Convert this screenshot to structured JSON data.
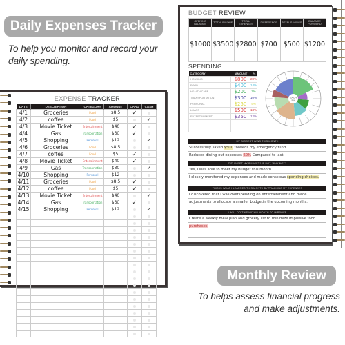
{
  "left_banner": {
    "title": "Daily Expenses Tracker",
    "subtitle": "To help you monitor and record your daily spending."
  },
  "right_banner": {
    "title": "Monthly Review",
    "subtitle_line1": "To helps assess financial progress",
    "subtitle_line2": "and make adjustments."
  },
  "expense_tracker": {
    "title_light": "EXPENSE",
    "title_bold": "TRACKER",
    "columns": [
      "DATE",
      "DESCRIPTION",
      "CATEGORY",
      "AMOUNT",
      "CARD",
      "CASH"
    ],
    "check_glyph": "✓",
    "category_colors": {
      "Food": "#f0a040",
      "Entertainment": "#e04848",
      "Transportation": "#3aaa55",
      "Personal": "#4a90d8"
    },
    "rows": [
      {
        "date": "4/1",
        "description": "Groceries",
        "category": "Food",
        "amount": "$8.5",
        "card": true,
        "cash": false
      },
      {
        "date": "4/2",
        "description": "coffee",
        "category": "Food",
        "amount": "$5",
        "card": false,
        "cash": true
      },
      {
        "date": "4/3",
        "description": "Movie Ticket",
        "category": "Entertainment",
        "amount": "$40",
        "card": true,
        "cash": false
      },
      {
        "date": "4/4",
        "description": "Gas",
        "category": "Transportation",
        "amount": "$30",
        "card": true,
        "cash": false
      },
      {
        "date": "4/5",
        "description": "Shopping",
        "category": "Personal",
        "amount": "$12",
        "card": false,
        "cash": true
      },
      {
        "date": "4/6",
        "description": "Groceries",
        "category": "Food",
        "amount": "$8.5",
        "card": false,
        "cash": false
      },
      {
        "date": "4/7",
        "description": "coffee",
        "category": "Food",
        "amount": "$5",
        "card": true,
        "cash": false
      },
      {
        "date": "4/8",
        "description": "Movie Ticket",
        "category": "Entertainment",
        "amount": "$40",
        "card": true,
        "cash": false
      },
      {
        "date": "4/9",
        "description": "Gas",
        "category": "Transportation",
        "amount": "$30",
        "card": false,
        "cash": true
      },
      {
        "date": "4/10",
        "description": "Shopping",
        "category": "Personal",
        "amount": "$12",
        "card": false,
        "cash": false
      },
      {
        "date": "4/11",
        "description": "Groceries",
        "category": "Food",
        "amount": "$8.5",
        "card": true,
        "cash": false
      },
      {
        "date": "4/12",
        "description": "coffee",
        "category": "Food",
        "amount": "$5",
        "card": true,
        "cash": false
      },
      {
        "date": "4/13",
        "description": "Movie Ticket",
        "category": "Entertainment",
        "amount": "$40",
        "card": false,
        "cash": true
      },
      {
        "date": "4/14",
        "description": "Gas",
        "category": "Transportation",
        "amount": "$30",
        "card": true,
        "cash": false
      },
      {
        "date": "4/15",
        "description": "Shopping",
        "category": "Personal",
        "amount": "$12",
        "card": false,
        "cash": true
      }
    ],
    "empty_rows": 18
  },
  "budget_review": {
    "title_light": "BUDGET",
    "title_bold": "REVIEW",
    "columns": [
      {
        "label": "OPENING BALANCE",
        "value": "$1000"
      },
      {
        "label": "TOTAL INCOME",
        "value": "$3500"
      },
      {
        "label": "TOTAL EXPENSES",
        "value": "$2800"
      },
      {
        "label": "DIFFERENCE",
        "value": "$700"
      },
      {
        "label": "TOTAL SAVINGS",
        "value": "$500"
      },
      {
        "label": "BALANCE FORWARD",
        "value": "$1200"
      }
    ]
  },
  "spending": {
    "title": "SPENDING",
    "columns": [
      "CATEGORY",
      "AMOUNT",
      "%"
    ],
    "rows": [
      {
        "category": "HOUSING",
        "amount": "$800",
        "pct": "28%",
        "color": "#e04848"
      },
      {
        "category": "FOOD",
        "amount": "$400",
        "pct": "14%",
        "color": "#40b8d8"
      },
      {
        "category": "HEALTH CARE",
        "amount": "$200",
        "pct": "7%",
        "color": "#3aaa55"
      },
      {
        "category": "TRANSPORTATION",
        "amount": "$300",
        "pct": "10%",
        "color": "#3a3a9a"
      },
      {
        "category": "PERSONAL",
        "amount": "$250",
        "pct": "9%",
        "color": "#d8d840"
      },
      {
        "category": "LOANS",
        "amount": "$500",
        "pct": "18%",
        "color": "#d83030"
      },
      {
        "category": "ENTERTAINMENT",
        "amount": "$350",
        "pct": "12%",
        "color": "#6a3a9a"
      }
    ],
    "empty_rows": 2
  },
  "chart_data": {
    "type": "polar-area",
    "center_label_line1": "EACH",
    "center_label_line2": "5%",
    "ring_step_pct": 5,
    "spokes": 20,
    "segments": [
      {
        "name": "segment-green",
        "color": "#6cc47a",
        "value": 28,
        "span_deg": 65
      },
      {
        "name": "segment-purple",
        "color": "#a46cc8",
        "value": 18,
        "span_deg": 30
      },
      {
        "name": "segment-dark-green",
        "color": "#3ea040",
        "value": 20,
        "span_deg": 35
      },
      {
        "name": "segment-teal",
        "color": "#70c8c8",
        "value": 22,
        "span_deg": 45
      },
      {
        "name": "segment-tan",
        "color": "#deb48c",
        "value": 26,
        "span_deg": 60
      },
      {
        "name": "segment-light-green",
        "color": "#b8dcb0",
        "value": 24,
        "span_deg": 40
      },
      {
        "name": "segment-brown",
        "color": "#a86060",
        "value": 27,
        "span_deg": 20
      },
      {
        "name": "segment-blue",
        "color": "#6c80cc",
        "value": 25,
        "span_deg": 65
      }
    ]
  },
  "reflections": [
    {
      "heading": "MY BIGGEST WINS THIS MONTH",
      "lines": [
        [
          {
            "t": "Successfully saved "
          },
          {
            "t": "$500",
            "hl": "y"
          },
          {
            "t": " towards my emergency fund."
          }
        ],
        [
          {
            "t": "Reduced dining-out expenses "
          },
          {
            "t": "60%",
            "hl": "r"
          },
          {
            "t": " Compared to last."
          }
        ]
      ]
    },
    {
      "heading": "DID I MEET MY BUDGET? IF NOT, WHY NOT?",
      "lines": [
        [
          {
            "t": "Yes, I was able to meet my budget this month."
          }
        ],
        [
          {
            "t": "I closely monitored my expenses and made conscious "
          },
          {
            "t": "spending choices.",
            "hl": "y"
          }
        ]
      ]
    },
    {
      "heading": "THIS IS WHAT I LEARNED THIS MONTH BY TRACKING MY EXPENSES",
      "lines": [
        [
          {
            "t": "I discovered that I was overspending on entertainment and made"
          }
        ],
        [
          {
            "t": "adjustments to allocate a smaller budgetin the upcoming months."
          }
        ]
      ]
    },
    {
      "heading": "I WILL DO THIS WITHIN MONTH TO IMPROVE",
      "lines": [
        [
          {
            "t": "Create a weekly meal plan and grocery list to minimize impulsive food"
          }
        ],
        [
          {
            "t": "purchases.",
            "hl": "r"
          }
        ],
        [
          {
            "t": ""
          }
        ]
      ]
    }
  ]
}
